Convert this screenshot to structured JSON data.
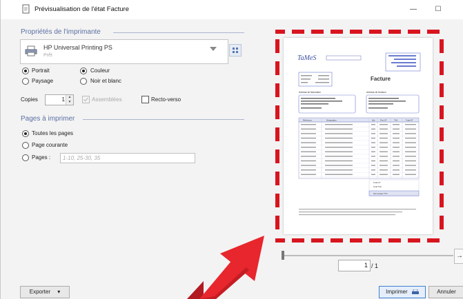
{
  "window": {
    "title": "Prévisualisation de l'état Facture",
    "minimize_glyph": "—",
    "maximize_glyph": "☐"
  },
  "printer_section": {
    "title": "Propriétés de l'imprimante",
    "printer_name": "HP Universal Printing PS",
    "printer_status": "Prêt",
    "orientation": {
      "portrait": "Portrait",
      "landscape": "Paysage",
      "selected": "portrait"
    },
    "color_mode": {
      "color": "Couleur",
      "bw": "Noir et blanc",
      "selected": "color"
    },
    "copies_label": "Copies",
    "copies_value": "1",
    "collate_label": "Assemblées",
    "duplex_label": "Recto-verso"
  },
  "pages_section": {
    "title": "Pages à imprimer",
    "all_pages": "Toutes les pages",
    "current_page": "Page courante",
    "pages_label": "Pages :",
    "pages_placeholder": "1-10, 25-30, 35",
    "selected": "all_pages"
  },
  "preview": {
    "invoice": {
      "logo": "TaMeS",
      "title": "Facture",
      "emitter_header": "Adresse de facturation",
      "recipient_header": "Adresse de livraison",
      "columns": [
        "Référence",
        "Désignation",
        "Qté",
        "Prix HT",
        "TVA",
        "Total HT"
      ],
      "totals": [
        "Total HT",
        "Total TVA",
        "Net à payer TTC"
      ]
    },
    "current_page": "1",
    "total_pages": "/ 1",
    "next_glyph": "→",
    "highlight_color": "#d8151f"
  },
  "footer": {
    "export_label": "Exporter",
    "export_caret": "▾",
    "print_label": "Imprimer",
    "cancel_label": "Annuler"
  },
  "colors": {
    "accent": "#5a6fa3",
    "highlight": "#d8151f",
    "arrow": "#e8262d"
  }
}
